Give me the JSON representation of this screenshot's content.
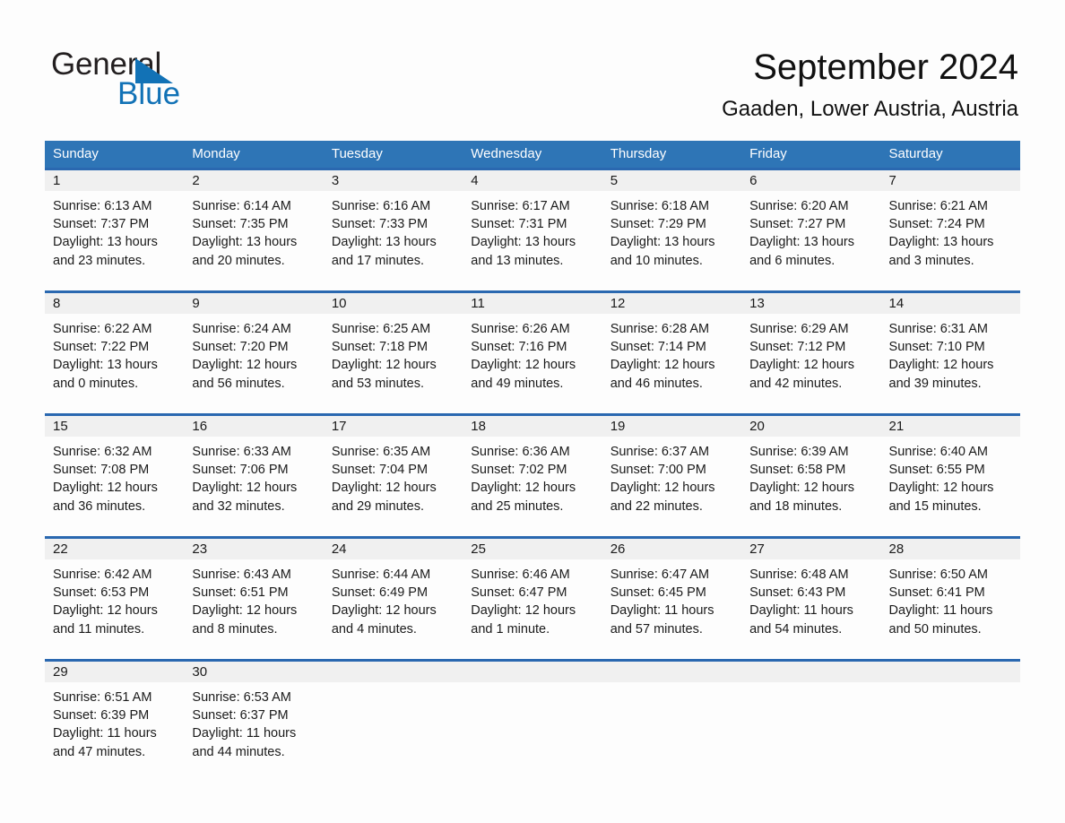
{
  "brand": {
    "name_part1": "General",
    "name_part2": "Blue",
    "triangle_color": "#1272b6",
    "text_color": "#231f20"
  },
  "header": {
    "month_title": "September 2024",
    "location": "Gaaden, Lower Austria, Austria"
  },
  "colors": {
    "header_band": "#2e75b6",
    "week_separator": "#2a68b0",
    "daynum_band": "#f0f0f0",
    "page_background": "#fdfdfd",
    "text": "#1a1a1a"
  },
  "weekdays": [
    "Sunday",
    "Monday",
    "Tuesday",
    "Wednesday",
    "Thursday",
    "Friday",
    "Saturday"
  ],
  "weeks": [
    {
      "days": [
        {
          "num": "1",
          "sunrise": "Sunrise: 6:13 AM",
          "sunset": "Sunset: 7:37 PM",
          "daylight1": "Daylight: 13 hours",
          "daylight2": "and 23 minutes."
        },
        {
          "num": "2",
          "sunrise": "Sunrise: 6:14 AM",
          "sunset": "Sunset: 7:35 PM",
          "daylight1": "Daylight: 13 hours",
          "daylight2": "and 20 minutes."
        },
        {
          "num": "3",
          "sunrise": "Sunrise: 6:16 AM",
          "sunset": "Sunset: 7:33 PM",
          "daylight1": "Daylight: 13 hours",
          "daylight2": "and 17 minutes."
        },
        {
          "num": "4",
          "sunrise": "Sunrise: 6:17 AM",
          "sunset": "Sunset: 7:31 PM",
          "daylight1": "Daylight: 13 hours",
          "daylight2": "and 13 minutes."
        },
        {
          "num": "5",
          "sunrise": "Sunrise: 6:18 AM",
          "sunset": "Sunset: 7:29 PM",
          "daylight1": "Daylight: 13 hours",
          "daylight2": "and 10 minutes."
        },
        {
          "num": "6",
          "sunrise": "Sunrise: 6:20 AM",
          "sunset": "Sunset: 7:27 PM",
          "daylight1": "Daylight: 13 hours",
          "daylight2": "and 6 minutes."
        },
        {
          "num": "7",
          "sunrise": "Sunrise: 6:21 AM",
          "sunset": "Sunset: 7:24 PM",
          "daylight1": "Daylight: 13 hours",
          "daylight2": "and 3 minutes."
        }
      ]
    },
    {
      "days": [
        {
          "num": "8",
          "sunrise": "Sunrise: 6:22 AM",
          "sunset": "Sunset: 7:22 PM",
          "daylight1": "Daylight: 13 hours",
          "daylight2": "and 0 minutes."
        },
        {
          "num": "9",
          "sunrise": "Sunrise: 6:24 AM",
          "sunset": "Sunset: 7:20 PM",
          "daylight1": "Daylight: 12 hours",
          "daylight2": "and 56 minutes."
        },
        {
          "num": "10",
          "sunrise": "Sunrise: 6:25 AM",
          "sunset": "Sunset: 7:18 PM",
          "daylight1": "Daylight: 12 hours",
          "daylight2": "and 53 minutes."
        },
        {
          "num": "11",
          "sunrise": "Sunrise: 6:26 AM",
          "sunset": "Sunset: 7:16 PM",
          "daylight1": "Daylight: 12 hours",
          "daylight2": "and 49 minutes."
        },
        {
          "num": "12",
          "sunrise": "Sunrise: 6:28 AM",
          "sunset": "Sunset: 7:14 PM",
          "daylight1": "Daylight: 12 hours",
          "daylight2": "and 46 minutes."
        },
        {
          "num": "13",
          "sunrise": "Sunrise: 6:29 AM",
          "sunset": "Sunset: 7:12 PM",
          "daylight1": "Daylight: 12 hours",
          "daylight2": "and 42 minutes."
        },
        {
          "num": "14",
          "sunrise": "Sunrise: 6:31 AM",
          "sunset": "Sunset: 7:10 PM",
          "daylight1": "Daylight: 12 hours",
          "daylight2": "and 39 minutes."
        }
      ]
    },
    {
      "days": [
        {
          "num": "15",
          "sunrise": "Sunrise: 6:32 AM",
          "sunset": "Sunset: 7:08 PM",
          "daylight1": "Daylight: 12 hours",
          "daylight2": "and 36 minutes."
        },
        {
          "num": "16",
          "sunrise": "Sunrise: 6:33 AM",
          "sunset": "Sunset: 7:06 PM",
          "daylight1": "Daylight: 12 hours",
          "daylight2": "and 32 minutes."
        },
        {
          "num": "17",
          "sunrise": "Sunrise: 6:35 AM",
          "sunset": "Sunset: 7:04 PM",
          "daylight1": "Daylight: 12 hours",
          "daylight2": "and 29 minutes."
        },
        {
          "num": "18",
          "sunrise": "Sunrise: 6:36 AM",
          "sunset": "Sunset: 7:02 PM",
          "daylight1": "Daylight: 12 hours",
          "daylight2": "and 25 minutes."
        },
        {
          "num": "19",
          "sunrise": "Sunrise: 6:37 AM",
          "sunset": "Sunset: 7:00 PM",
          "daylight1": "Daylight: 12 hours",
          "daylight2": "and 22 minutes."
        },
        {
          "num": "20",
          "sunrise": "Sunrise: 6:39 AM",
          "sunset": "Sunset: 6:58 PM",
          "daylight1": "Daylight: 12 hours",
          "daylight2": "and 18 minutes."
        },
        {
          "num": "21",
          "sunrise": "Sunrise: 6:40 AM",
          "sunset": "Sunset: 6:55 PM",
          "daylight1": "Daylight: 12 hours",
          "daylight2": "and 15 minutes."
        }
      ]
    },
    {
      "days": [
        {
          "num": "22",
          "sunrise": "Sunrise: 6:42 AM",
          "sunset": "Sunset: 6:53 PM",
          "daylight1": "Daylight: 12 hours",
          "daylight2": "and 11 minutes."
        },
        {
          "num": "23",
          "sunrise": "Sunrise: 6:43 AM",
          "sunset": "Sunset: 6:51 PM",
          "daylight1": "Daylight: 12 hours",
          "daylight2": "and 8 minutes."
        },
        {
          "num": "24",
          "sunrise": "Sunrise: 6:44 AM",
          "sunset": "Sunset: 6:49 PM",
          "daylight1": "Daylight: 12 hours",
          "daylight2": "and 4 minutes."
        },
        {
          "num": "25",
          "sunrise": "Sunrise: 6:46 AM",
          "sunset": "Sunset: 6:47 PM",
          "daylight1": "Daylight: 12 hours",
          "daylight2": "and 1 minute."
        },
        {
          "num": "26",
          "sunrise": "Sunrise: 6:47 AM",
          "sunset": "Sunset: 6:45 PM",
          "daylight1": "Daylight: 11 hours",
          "daylight2": "and 57 minutes."
        },
        {
          "num": "27",
          "sunrise": "Sunrise: 6:48 AM",
          "sunset": "Sunset: 6:43 PM",
          "daylight1": "Daylight: 11 hours",
          "daylight2": "and 54 minutes."
        },
        {
          "num": "28",
          "sunrise": "Sunrise: 6:50 AM",
          "sunset": "Sunset: 6:41 PM",
          "daylight1": "Daylight: 11 hours",
          "daylight2": "and 50 minutes."
        }
      ]
    },
    {
      "days": [
        {
          "num": "29",
          "sunrise": "Sunrise: 6:51 AM",
          "sunset": "Sunset: 6:39 PM",
          "daylight1": "Daylight: 11 hours",
          "daylight2": "and 47 minutes."
        },
        {
          "num": "30",
          "sunrise": "Sunrise: 6:53 AM",
          "sunset": "Sunset: 6:37 PM",
          "daylight1": "Daylight: 11 hours",
          "daylight2": "and 44 minutes."
        },
        {
          "num": "",
          "sunrise": "",
          "sunset": "",
          "daylight1": "",
          "daylight2": ""
        },
        {
          "num": "",
          "sunrise": "",
          "sunset": "",
          "daylight1": "",
          "daylight2": ""
        },
        {
          "num": "",
          "sunrise": "",
          "sunset": "",
          "daylight1": "",
          "daylight2": ""
        },
        {
          "num": "",
          "sunrise": "",
          "sunset": "",
          "daylight1": "",
          "daylight2": ""
        },
        {
          "num": "",
          "sunrise": "",
          "sunset": "",
          "daylight1": "",
          "daylight2": ""
        }
      ]
    }
  ]
}
